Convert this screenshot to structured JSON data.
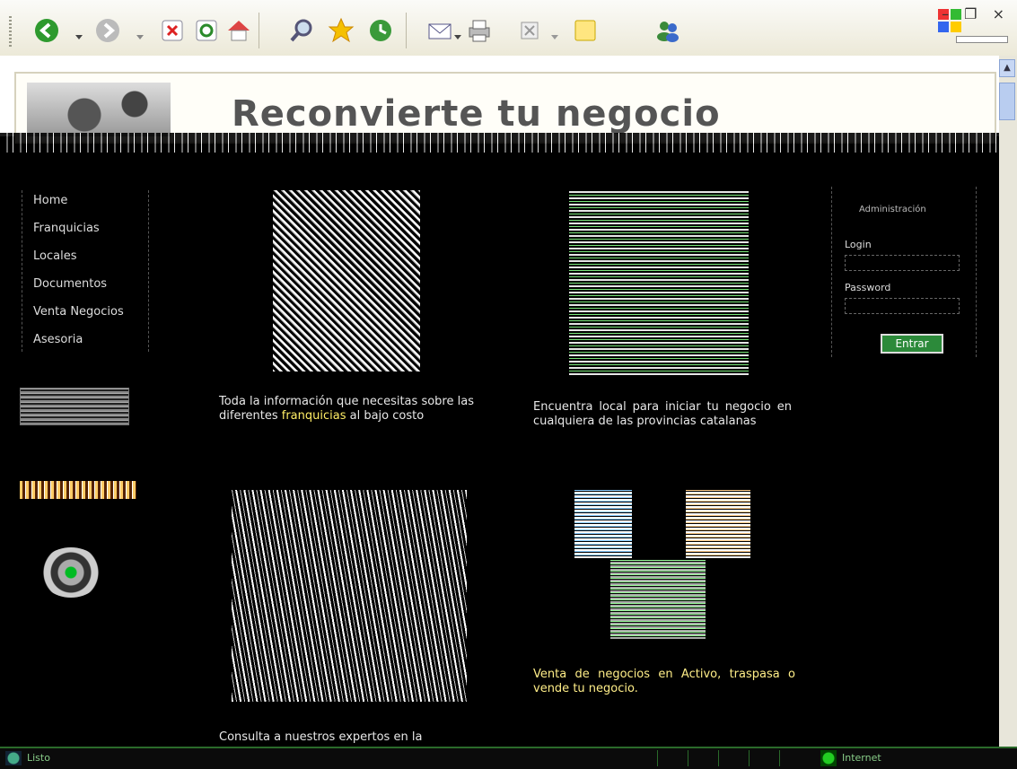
{
  "toolbar": {
    "buttons": [
      "back-icon",
      "forward-icon",
      "stop-icon",
      "refresh-icon",
      "home-icon",
      "search-icon",
      "favorites-icon",
      "history-icon",
      "mail-icon",
      "print-icon",
      "edit-icon",
      "notes-icon",
      "messenger-icon"
    ]
  },
  "window": {
    "controls": "– ❐ ×"
  },
  "header": {
    "title": "Reconvierte tu negocio"
  },
  "nav": {
    "items": [
      {
        "label": "Home"
      },
      {
        "label": "Franquicias"
      },
      {
        "label": "Locales"
      },
      {
        "label": "Documentos"
      },
      {
        "label": "Venta Negocios"
      },
      {
        "label": "Asesoria"
      }
    ]
  },
  "content": {
    "p1_a": "Toda la información que necesitas sobre las diferentes ",
    "p1_hl": "franquicias",
    "p1_b": " al bajo costo",
    "p2": "Encuentra local para iniciar tu negocio en cualquiera de las provincias catalanas",
    "p3": "Venta de negocios en Activo, traspasa o vende tu negocio.",
    "p4": "Consulta a nuestros expertos en la"
  },
  "login": {
    "title": "Administración",
    "user_label": "Login",
    "password_label": "Password",
    "button_label": "Entrar"
  },
  "status": {
    "text": "Listo",
    "zone": "Internet"
  },
  "colors": {
    "background": "#000000",
    "highlight": "#ffee66",
    "button": "#2c8a3a"
  }
}
